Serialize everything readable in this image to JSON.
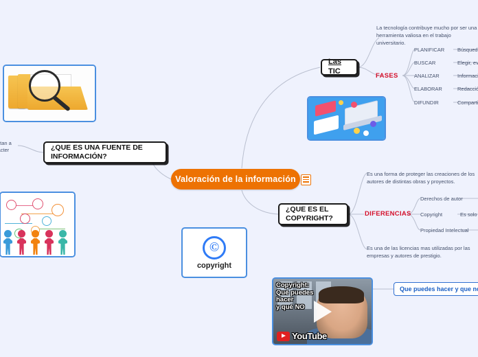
{
  "background_color": "#eff2fd",
  "central_node": {
    "label": "Valoración de la información",
    "color": "#ED7203",
    "note_icon": "list-note-icon"
  },
  "branches": {
    "tic": {
      "title": "Las TIC",
      "description": "La tecnología contribuye mucho por ser una herramienta valiosa en el trabajo universitario.",
      "group_label": "FASES",
      "group_label_color": "#d4112b",
      "phases": [
        {
          "name": "PLANIFICAR",
          "detail": "Búsqueda"
        },
        {
          "name": "BUSCAR",
          "detail": "Elegir, evaluar"
        },
        {
          "name": "ANALIZAR",
          "detail": "Información"
        },
        {
          "name": "ELABORAR",
          "detail": "Redacción a"
        },
        {
          "name": "DIFUNDIR",
          "detail": "Compartir e"
        }
      ]
    },
    "copyright": {
      "title": "¿QUE ES EL COPYRIGHT?",
      "description_top": "Es una forma de proteger las creaciones de los autores de distintas obras y proyectos.",
      "description_bottom": "Es una de las licencias mas utilizadas por las empresas y autores de prestigio.",
      "group_label": "DIFERENCIAS",
      "group_label_color": "#d4112b",
      "items": [
        {
          "name": "Derechos de autor",
          "detail": ""
        },
        {
          "name": "Copyright",
          "detail": "Es solo"
        },
        {
          "name": "Propiedad Intelectual",
          "detail": ""
        }
      ]
    },
    "fuente": {
      "title": "¿QUE ES UNA FUENTE DE INFORMACIÓN?",
      "clipped_text_line1": "ntan a",
      "clipped_text_line2": "rácter"
    },
    "video_callout": {
      "label": "Que puedes hacer y que no h",
      "color": "#1a5fc4"
    }
  },
  "images": {
    "folder_search": {
      "name": "folder-magnifier-image"
    },
    "people_network": {
      "name": "people-network-image"
    },
    "tic_illustration": {
      "name": "elearning-isometric-image"
    },
    "copyright_logo": {
      "glyph": "©",
      "caption": "copyright",
      "color": "#2f7bf6"
    },
    "youtube_video": {
      "caption_lines": [
        "Copyright:",
        "Qué puedes",
        "hacer",
        "y qué NO"
      ],
      "brand": "YouTube",
      "play_icon": "play-icon"
    }
  }
}
